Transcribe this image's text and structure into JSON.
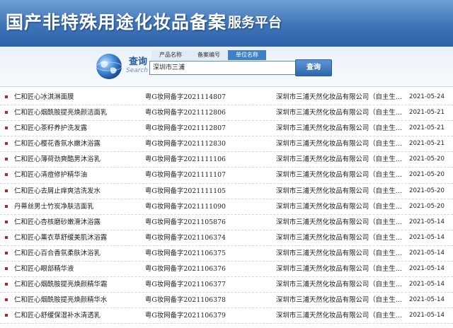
{
  "header": {
    "title": "国产非特殊用途化妆品备案",
    "subtitle": "服务平台"
  },
  "search": {
    "label_cn": "查询",
    "label_en": "Search",
    "tabs": [
      {
        "label": "产品名称"
      },
      {
        "label": "备案编号"
      },
      {
        "label": "单位名称"
      }
    ],
    "active_tab": "单位名称",
    "input_value": "深圳市三浦",
    "button_label": "查询"
  },
  "records": [
    {
      "name": "仁和匠心冰淇淋面膜",
      "code": "粤G妆网备字2021114807",
      "company": "深圳市三浦天然化妆品有限公司（自主生…",
      "date": "2021-05-24"
    },
    {
      "name": "仁和匠心烟酰胺提亮焕颜洁面乳",
      "code": "粤G妆网备字2021112806",
      "company": "深圳市三浦天然化妆品有限公司（自主生…",
      "date": "2021-05-21"
    },
    {
      "name": "仁和匠心茶籽养护洗发露",
      "code": "粤G妆网备字2021112807",
      "company": "深圳市三浦天然化妆品有限公司（自主生…",
      "date": "2021-05-21"
    },
    {
      "name": "仁和匠心樱花香氛水嫩沐浴露",
      "code": "粤G妆网备字2021112830",
      "company": "深圳市三浦天然化妆品有限公司（自主生…",
      "date": "2021-05-21"
    },
    {
      "name": "仁和匠心薄荷劲爽酷男沐浴乳",
      "code": "粤G妆网备字2021111106",
      "company": "深圳市三浦天然化妆品有限公司（自主生…",
      "date": "2021-05-20"
    },
    {
      "name": "仁和匠心清痘修护精华油",
      "code": "粤G妆网备字2021111107",
      "company": "深圳市三浦天然化妆品有限公司（自主生…",
      "date": "2021-05-20"
    },
    {
      "name": "仁和匠心去屑止痒爽洁洗发水",
      "code": "粤G妆网备字2021111105",
      "company": "深圳市三浦天然化妆品有限公司（自主生…",
      "date": "2021-05-20"
    },
    {
      "name": "丹蒂丝男士竹炭净肤洁面乳",
      "code": "粤G妆网备字2021111090",
      "company": "深圳市三浦天然化妆品有限公司（自主生…",
      "date": "2021-05-20"
    },
    {
      "name": "仁和匠心杏核磨砂嫩滑沐浴露",
      "code": "粤G妆网备字2021105876",
      "company": "深圳市三浦天然化妆品有限公司（自主生…",
      "date": "2021-05-14"
    },
    {
      "name": "仁和匠心薰衣草舒缓美肌沐浴露",
      "code": "粤G妆网备字2021106374",
      "company": "深圳市三浦天然化妆品有限公司（自主生…",
      "date": "2021-05-14"
    },
    {
      "name": "仁和匠心百合香氛柔肤沐浴乳",
      "code": "粤G妆网备字2021106375",
      "company": "深圳市三浦天然化妆品有限公司（自主生…",
      "date": "2021-05-14"
    },
    {
      "name": "仁和匠心眼部精华液",
      "code": "粤G妆网备字2021106376",
      "company": "深圳市三浦天然化妆品有限公司（自主生…",
      "date": "2021-05-14"
    },
    {
      "name": "仁和匠心烟酰胺提亮焕颜精华霜",
      "code": "粤G妆网备字2021106377",
      "company": "深圳市三浦天然化妆品有限公司（自主生…",
      "date": "2021-05-14"
    },
    {
      "name": "仁和匠心烟酰胺提亮焕颜精华水",
      "code": "粤G妆网备字2021106378",
      "company": "深圳市三浦天然化妆品有限公司（自主生…",
      "date": "2021-05-14"
    },
    {
      "name": "仁和匠心舒缓保湿补水清透乳",
      "code": "粤G妆网备字2021106379",
      "company": "深圳市三浦天然化妆品有限公司（自主生…",
      "date": "2021-05-14"
    }
  ],
  "colors": {
    "banner": "#3e74b8",
    "bullet": "#b0281e",
    "active_tab": "#3f7fc6"
  },
  "icons": {
    "bullet": "square-bullet-icon",
    "globe": "globe-icon"
  }
}
